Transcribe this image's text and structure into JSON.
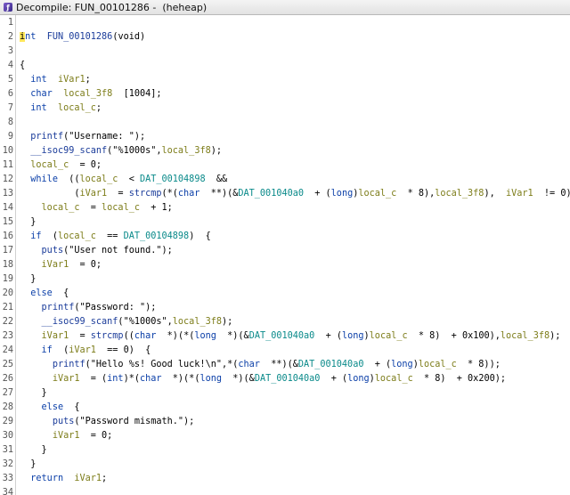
{
  "window": {
    "title": "Decompile: FUN_00101286 -  (heheap)",
    "icon": "ghidra-decompile-icon"
  },
  "colors": {
    "keyword": "#0b3fa8",
    "function": "#1b3c9a",
    "variable": "#7d7d1a",
    "global": "#0a8a8a",
    "cursor": "#ffe75a"
  },
  "lines": [
    {
      "n": "1",
      "tokens": []
    },
    {
      "n": "2",
      "tokens": [
        [
          "cur",
          "i"
        ],
        [
          "kw",
          "nt"
        ],
        [
          "",
          "  "
        ],
        [
          "fn",
          "FUN_00101286"
        ],
        [
          "",
          "(void)"
        ]
      ]
    },
    {
      "n": "3",
      "tokens": []
    },
    {
      "n": "4",
      "tokens": [
        [
          "",
          "{"
        ]
      ]
    },
    {
      "n": "5",
      "tokens": [
        [
          "",
          "  "
        ],
        [
          "kw",
          "int"
        ],
        [
          "",
          "  "
        ],
        [
          "var",
          "iVar1"
        ],
        [
          "",
          ";"
        ]
      ]
    },
    {
      "n": "6",
      "tokens": [
        [
          "",
          "  "
        ],
        [
          "kw",
          "char"
        ],
        [
          "",
          "  "
        ],
        [
          "var",
          "local_3f8"
        ],
        [
          "",
          "  [1004];"
        ]
      ]
    },
    {
      "n": "7",
      "tokens": [
        [
          "",
          "  "
        ],
        [
          "kw",
          "int"
        ],
        [
          "",
          "  "
        ],
        [
          "var",
          "local_c"
        ],
        [
          "",
          ";"
        ]
      ]
    },
    {
      "n": "8",
      "tokens": []
    },
    {
      "n": "9",
      "tokens": [
        [
          "",
          "  "
        ],
        [
          "fn",
          "printf"
        ],
        [
          "",
          "("
        ],
        [
          "str",
          "\"Username: \""
        ],
        [
          "",
          ");"
        ]
      ]
    },
    {
      "n": "10",
      "tokens": [
        [
          "",
          "  "
        ],
        [
          "fn",
          "__isoc99_scanf"
        ],
        [
          "",
          "("
        ],
        [
          "str",
          "\"%1000s\""
        ],
        [
          "",
          ","
        ],
        [
          "var",
          "local_3f8"
        ],
        [
          "",
          ");"
        ]
      ]
    },
    {
      "n": "11",
      "tokens": [
        [
          "",
          "  "
        ],
        [
          "var",
          "local_c"
        ],
        [
          "",
          "  = 0;"
        ]
      ]
    },
    {
      "n": "12",
      "tokens": [
        [
          "",
          "  "
        ],
        [
          "kw",
          "while"
        ],
        [
          "",
          "  (("
        ],
        [
          "var",
          "local_c"
        ],
        [
          "",
          "  < "
        ],
        [
          "glb",
          "DAT_00104898"
        ],
        [
          "",
          "  &&"
        ]
      ]
    },
    {
      "n": "13",
      "tokens": [
        [
          "",
          "          ("
        ],
        [
          "var",
          "iVar1"
        ],
        [
          "",
          "  = "
        ],
        [
          "fn",
          "strcmp"
        ],
        [
          "",
          "(*("
        ],
        [
          "kw",
          "char"
        ],
        [
          "",
          "  **)(&"
        ],
        [
          "glb",
          "DAT_001040a0"
        ],
        [
          "",
          "  + ("
        ],
        [
          "kw",
          "long"
        ],
        [
          "",
          ")"
        ],
        [
          "var",
          "local_c"
        ],
        [
          "",
          "  * 8),"
        ],
        [
          "var",
          "local_3f8"
        ],
        [
          "",
          "),  "
        ],
        [
          "var",
          "iVar1"
        ],
        [
          "",
          "  != 0)))  {"
        ]
      ]
    },
    {
      "n": "14",
      "tokens": [
        [
          "",
          "    "
        ],
        [
          "var",
          "local_c"
        ],
        [
          "",
          "  = "
        ],
        [
          "var",
          "local_c"
        ],
        [
          "",
          "  + 1;"
        ]
      ]
    },
    {
      "n": "15",
      "tokens": [
        [
          "",
          "  }"
        ]
      ]
    },
    {
      "n": "16",
      "tokens": [
        [
          "",
          "  "
        ],
        [
          "kw",
          "if"
        ],
        [
          "",
          "  ("
        ],
        [
          "var",
          "local_c"
        ],
        [
          "",
          "  == "
        ],
        [
          "glb",
          "DAT_00104898"
        ],
        [
          "",
          ")  {"
        ]
      ]
    },
    {
      "n": "17",
      "tokens": [
        [
          "",
          "    "
        ],
        [
          "fn",
          "puts"
        ],
        [
          "",
          "("
        ],
        [
          "str",
          "\"User not found.\""
        ],
        [
          "",
          ");"
        ]
      ]
    },
    {
      "n": "18",
      "tokens": [
        [
          "",
          "    "
        ],
        [
          "var",
          "iVar1"
        ],
        [
          "",
          "  = 0;"
        ]
      ]
    },
    {
      "n": "19",
      "tokens": [
        [
          "",
          "  }"
        ]
      ]
    },
    {
      "n": "20",
      "tokens": [
        [
          "",
          "  "
        ],
        [
          "kw",
          "else"
        ],
        [
          "",
          "  {"
        ]
      ]
    },
    {
      "n": "21",
      "tokens": [
        [
          "",
          "    "
        ],
        [
          "fn",
          "printf"
        ],
        [
          "",
          "("
        ],
        [
          "str",
          "\"Password: \""
        ],
        [
          "",
          ");"
        ]
      ]
    },
    {
      "n": "22",
      "tokens": [
        [
          "",
          "    "
        ],
        [
          "fn",
          "__isoc99_scanf"
        ],
        [
          "",
          "("
        ],
        [
          "str",
          "\"%1000s\""
        ],
        [
          "",
          ","
        ],
        [
          "var",
          "local_3f8"
        ],
        [
          "",
          ");"
        ]
      ]
    },
    {
      "n": "23",
      "tokens": [
        [
          "",
          "    "
        ],
        [
          "var",
          "iVar1"
        ],
        [
          "",
          "  = "
        ],
        [
          "fn",
          "strcmp"
        ],
        [
          "",
          "(("
        ],
        [
          "kw",
          "char"
        ],
        [
          "",
          "  *)(*("
        ],
        [
          "kw",
          "long"
        ],
        [
          "",
          "  *)(&"
        ],
        [
          "glb",
          "DAT_001040a0"
        ],
        [
          "",
          "  + ("
        ],
        [
          "kw",
          "long"
        ],
        [
          "",
          ")"
        ],
        [
          "var",
          "local_c"
        ],
        [
          "",
          "  * 8)  + 0x100),"
        ],
        [
          "var",
          "local_3f8"
        ],
        [
          "",
          ");"
        ]
      ]
    },
    {
      "n": "24",
      "tokens": [
        [
          "",
          "    "
        ],
        [
          "kw",
          "if"
        ],
        [
          "",
          "  ("
        ],
        [
          "var",
          "iVar1"
        ],
        [
          "",
          "  == 0)  {"
        ]
      ]
    },
    {
      "n": "25",
      "tokens": [
        [
          "",
          "      "
        ],
        [
          "fn",
          "printf"
        ],
        [
          "",
          "("
        ],
        [
          "str",
          "\"Hello %s! Good luck!\\n\""
        ],
        [
          "",
          ",*("
        ],
        [
          "kw",
          "char"
        ],
        [
          "",
          "  **)(&"
        ],
        [
          "glb",
          "DAT_001040a0"
        ],
        [
          "",
          "  + ("
        ],
        [
          "kw",
          "long"
        ],
        [
          "",
          ")"
        ],
        [
          "var",
          "local_c"
        ],
        [
          "",
          "  * 8));"
        ]
      ]
    },
    {
      "n": "26",
      "tokens": [
        [
          "",
          "      "
        ],
        [
          "var",
          "iVar1"
        ],
        [
          "",
          "  = ("
        ],
        [
          "kw",
          "int"
        ],
        [
          "",
          ")*("
        ],
        [
          "kw",
          "char"
        ],
        [
          "",
          "  *)(*("
        ],
        [
          "kw",
          "long"
        ],
        [
          "",
          "  *)(&"
        ],
        [
          "glb",
          "DAT_001040a0"
        ],
        [
          "",
          "  + ("
        ],
        [
          "kw",
          "long"
        ],
        [
          "",
          ")"
        ],
        [
          "var",
          "local_c"
        ],
        [
          "",
          "  * 8)  + 0x200);"
        ]
      ]
    },
    {
      "n": "27",
      "tokens": [
        [
          "",
          "    }"
        ]
      ]
    },
    {
      "n": "28",
      "tokens": [
        [
          "",
          "    "
        ],
        [
          "kw",
          "else"
        ],
        [
          "",
          "  {"
        ]
      ]
    },
    {
      "n": "29",
      "tokens": [
        [
          "",
          "      "
        ],
        [
          "fn",
          "puts"
        ],
        [
          "",
          "("
        ],
        [
          "str",
          "\"Password mismath.\""
        ],
        [
          "",
          ");"
        ]
      ]
    },
    {
      "n": "30",
      "tokens": [
        [
          "",
          "      "
        ],
        [
          "var",
          "iVar1"
        ],
        [
          "",
          "  = 0;"
        ]
      ]
    },
    {
      "n": "31",
      "tokens": [
        [
          "",
          "    }"
        ]
      ]
    },
    {
      "n": "32",
      "tokens": [
        [
          "",
          "  }"
        ]
      ]
    },
    {
      "n": "33",
      "tokens": [
        [
          "",
          "  "
        ],
        [
          "kw",
          "return"
        ],
        [
          "",
          "  "
        ],
        [
          "var",
          "iVar1"
        ],
        [
          "",
          ";"
        ]
      ]
    },
    {
      "n": "34",
      "tokens": []
    }
  ]
}
